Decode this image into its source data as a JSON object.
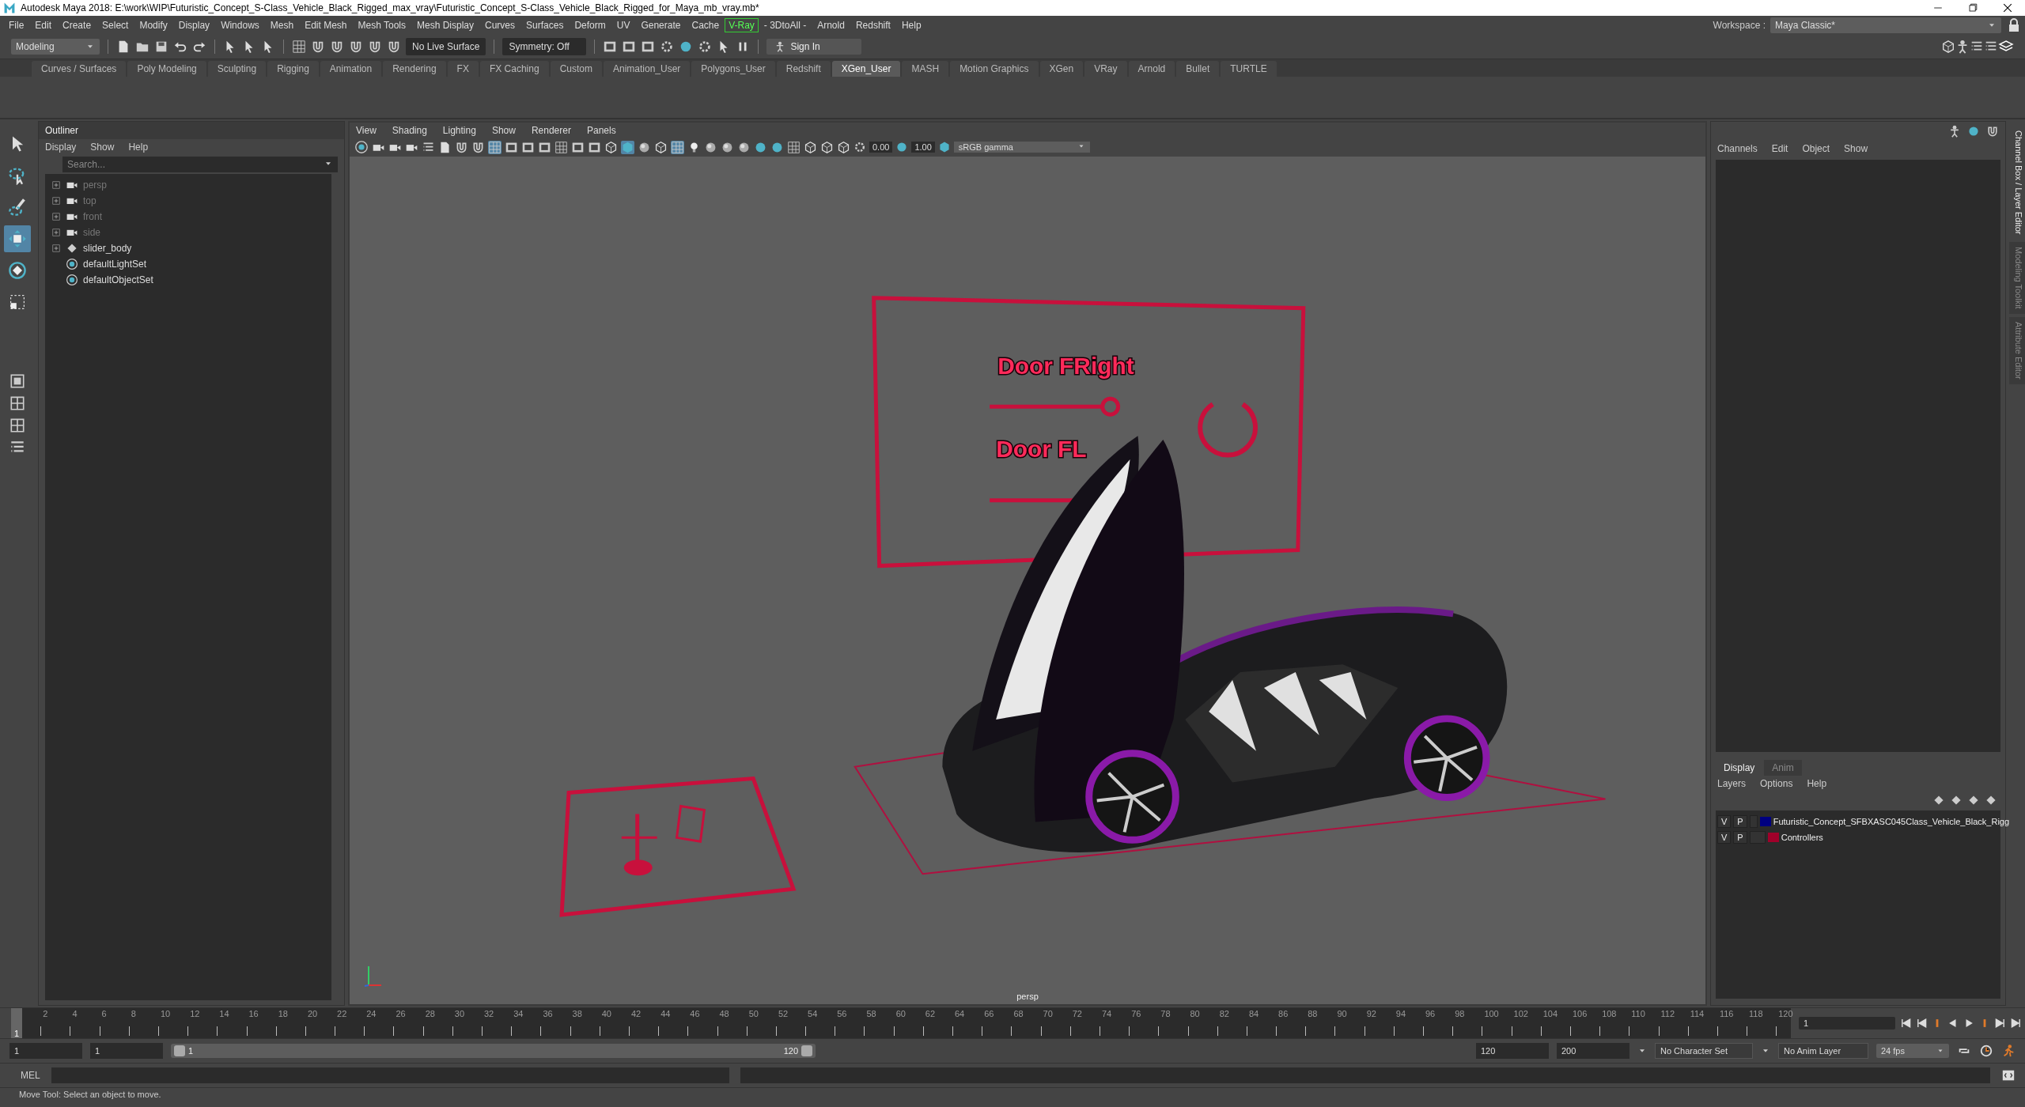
{
  "window": {
    "title": "Autodesk Maya 2018: E:\\work\\WIP\\Futuristic_Concept_S-Class_Vehicle_Black_Rigged_max_vray\\Futuristic_Concept_S-Class_Vehicle_Black_Rigged_for_Maya_mb_vray.mb*"
  },
  "menu_bar": [
    {
      "label": "File",
      "highlighted": false
    },
    {
      "label": "Edit",
      "highlighted": false
    },
    {
      "label": "Create",
      "highlighted": false
    },
    {
      "label": "Select",
      "highlighted": false
    },
    {
      "label": "Modify",
      "highlighted": false
    },
    {
      "label": "Display",
      "highlighted": false
    },
    {
      "label": "Windows",
      "highlighted": false
    },
    {
      "label": "Mesh",
      "highlighted": false
    },
    {
      "label": "Edit Mesh",
      "highlighted": false
    },
    {
      "label": "Mesh Tools",
      "highlighted": false
    },
    {
      "label": "Mesh Display",
      "highlighted": false
    },
    {
      "label": "Curves",
      "highlighted": false
    },
    {
      "label": "Surfaces",
      "highlighted": false
    },
    {
      "label": "Deform",
      "highlighted": false
    },
    {
      "label": "UV",
      "highlighted": false
    },
    {
      "label": "Generate",
      "highlighted": false
    },
    {
      "label": "Cache",
      "highlighted": false
    },
    {
      "label": "V-Ray",
      "highlighted": true
    },
    {
      "label": "- 3DtoAll -",
      "highlighted": false
    },
    {
      "label": "Arnold",
      "highlighted": false
    },
    {
      "label": "Redshift",
      "highlighted": false
    },
    {
      "label": "Help",
      "highlighted": false
    }
  ],
  "workspace": {
    "label": "Workspace :",
    "value": "Maya Classic*"
  },
  "toolbar": {
    "mode": "Modeling",
    "live_surface": "No Live Surface",
    "symmetry": "Symmetry: Off",
    "sign_in": "Sign In"
  },
  "shelf_tabs": [
    {
      "label": "Curves / Surfaces",
      "selected": false
    },
    {
      "label": "Poly Modeling",
      "selected": false
    },
    {
      "label": "Sculpting",
      "selected": false
    },
    {
      "label": "Rigging",
      "selected": false
    },
    {
      "label": "Animation",
      "selected": false
    },
    {
      "label": "Rendering",
      "selected": false
    },
    {
      "label": "FX",
      "selected": false
    },
    {
      "label": "FX Caching",
      "selected": false
    },
    {
      "label": "Custom",
      "selected": false
    },
    {
      "label": "Animation_User",
      "selected": false
    },
    {
      "label": "Polygons_User",
      "selected": false
    },
    {
      "label": "Redshift",
      "selected": false
    },
    {
      "label": "XGen_User",
      "selected": true
    },
    {
      "label": "MASH",
      "selected": false
    },
    {
      "label": "Motion Graphics",
      "selected": false
    },
    {
      "label": "XGen",
      "selected": false
    },
    {
      "label": "VRay",
      "selected": false
    },
    {
      "label": "Arnold",
      "selected": false
    },
    {
      "label": "Bullet",
      "selected": false
    },
    {
      "label": "TURTLE",
      "selected": false
    }
  ],
  "tool_box": [
    {
      "kind": "select",
      "selected": false
    },
    {
      "kind": "lasso",
      "selected": false
    },
    {
      "kind": "paint",
      "selected": false
    },
    {
      "kind": "move",
      "selected": true
    },
    {
      "kind": "rotate",
      "selected": false
    },
    {
      "kind": "scale",
      "selected": false
    }
  ],
  "outliner": {
    "title": "Outliner",
    "menus": [
      "Display",
      "Show",
      "Help"
    ],
    "search": {
      "placeholder": "Search..."
    },
    "items": [
      {
        "label": "persp",
        "kind": "camera",
        "dimmed": true,
        "expandable": true
      },
      {
        "label": "top",
        "kind": "camera",
        "dimmed": true,
        "expandable": true
      },
      {
        "label": "front",
        "kind": "camera",
        "dimmed": true,
        "expandable": true
      },
      {
        "label": "side",
        "kind": "camera",
        "dimmed": true,
        "expandable": true
      },
      {
        "label": "slider_body",
        "kind": "transform",
        "dimmed": false,
        "expandable": true
      },
      {
        "label": "defaultLightSet",
        "kind": "set",
        "dimmed": false,
        "expandable": false
      },
      {
        "label": "defaultObjectSet",
        "kind": "set",
        "dimmed": false,
        "expandable": false
      }
    ]
  },
  "viewport": {
    "menus": [
      "View",
      "Shading",
      "Lighting",
      "Show",
      "Renderer",
      "Panels"
    ],
    "exposure": "0.00",
    "gamma": "1.00",
    "color_space": "sRGB gamma",
    "scene_labels": [
      "Door FRight",
      "Door FL"
    ],
    "camera": "persp"
  },
  "channel_box": {
    "menus": [
      "Channels",
      "Edit",
      "Object",
      "Show"
    ]
  },
  "side_tabs": [
    {
      "label": "Channel Box / Layer Editor",
      "selected": true
    },
    {
      "label": "Modeling Toolkit",
      "selected": false
    },
    {
      "label": "Attribute Editor",
      "selected": false
    }
  ],
  "layer_editor": {
    "tabs": [
      {
        "label": "Display",
        "selected": true
      },
      {
        "label": "Anim",
        "selected": false
      }
    ],
    "menus": [
      "Layers",
      "Options",
      "Help"
    ],
    "layers": [
      {
        "visible": "V",
        "playback": "P",
        "color": "#000080",
        "name": "Futuristic_Concept_SFBXASC045Class_Vehicle_Black_Rigg"
      },
      {
        "visible": "V",
        "playback": "P",
        "color": "#a0002a",
        "name": "Controllers"
      }
    ]
  },
  "timeline": {
    "current": "1",
    "level": 0,
    "ticks": [
      "2",
      "4",
      "6",
      "8",
      "10",
      "12",
      "14",
      "16",
      "18",
      "20",
      "22",
      "24",
      "26",
      "28",
      "30",
      "32",
      "34",
      "36",
      "38",
      "40",
      "42",
      "44",
      "46",
      "48",
      "50",
      "52",
      "54",
      "56",
      "58",
      "60",
      "62",
      "64",
      "66",
      "68",
      "70",
      "72",
      "74",
      "76",
      "78",
      "80",
      "82",
      "84",
      "86",
      "88",
      "90",
      "92",
      "94",
      "96",
      "98",
      "100",
      "102",
      "104",
      "106",
      "108",
      "110",
      "112",
      "114",
      "116",
      "118",
      "120"
    ],
    "frame_field": "1"
  },
  "range": {
    "start": "1",
    "playback_start": "1",
    "slider_start": "1",
    "slider_end": "120",
    "level": 1,
    "playback_end": "120",
    "end": "200",
    "character_set": "No Character Set",
    "anim_layer": "No Anim Layer",
    "fps": "24 fps"
  },
  "command_line": {
    "label": "MEL"
  },
  "help_line": "Move Tool: Select an object to move."
}
